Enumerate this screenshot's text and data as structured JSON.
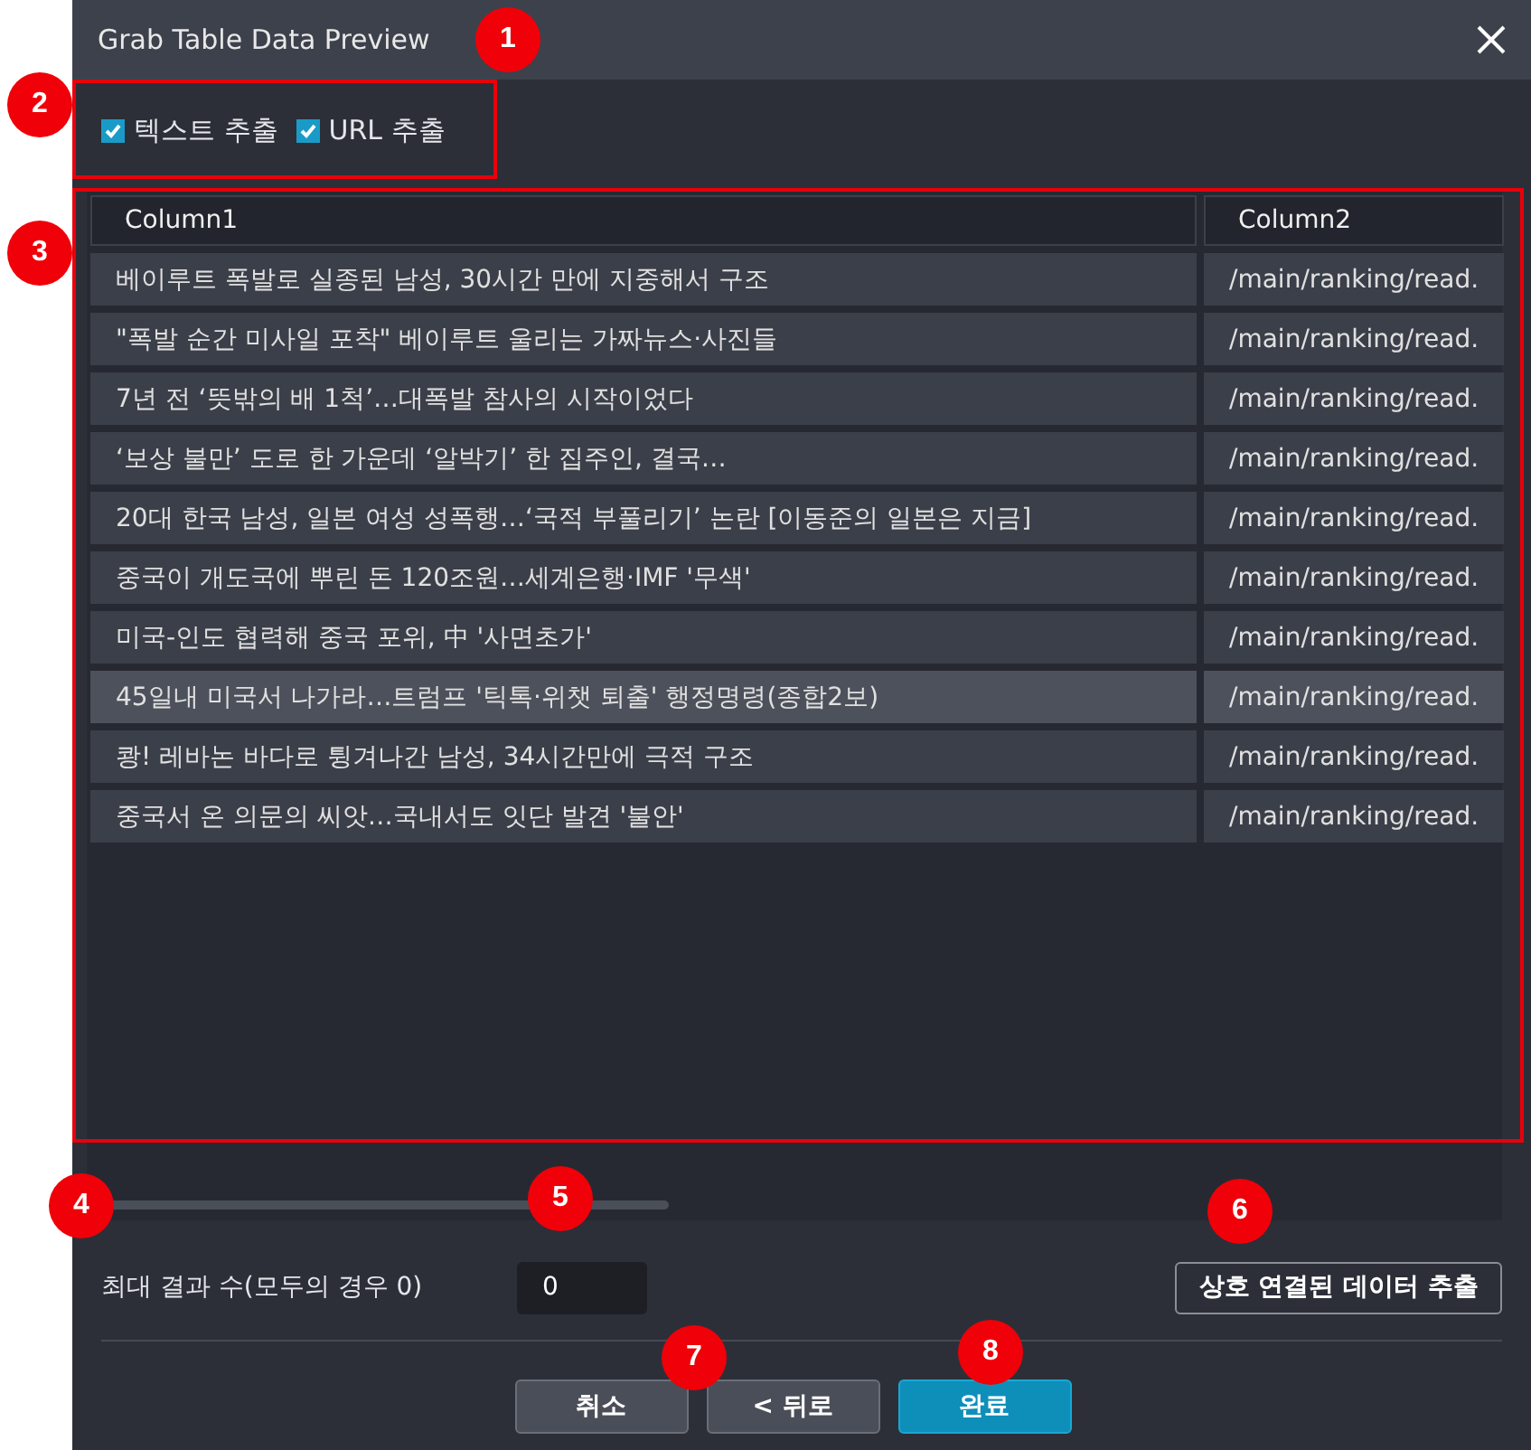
{
  "window": {
    "title": "Grab Table Data Preview"
  },
  "options": [
    {
      "label": "텍스트 추출",
      "checked": true
    },
    {
      "label": "URL 추출",
      "checked": true
    }
  ],
  "table": {
    "columns": [
      "Column1",
      "Column2"
    ],
    "rows": [
      {
        "cells": [
          "베이루트 폭발로 실종된 남성, 30시간 만에 지중해서 구조",
          "/main/ranking/read."
        ],
        "selected": false
      },
      {
        "cells": [
          "\"폭발 순간 미사일 포착\" 베이루트 울리는 가짜뉴스·사진들",
          "/main/ranking/read."
        ],
        "selected": false
      },
      {
        "cells": [
          "7년 전 ‘뜻밖의 배 1척’…대폭발 참사의 시작이었다",
          "/main/ranking/read."
        ],
        "selected": false
      },
      {
        "cells": [
          "‘보상 불만’ 도로 한 가운데 ‘알박기’ 한 집주인, 결국…",
          "/main/ranking/read."
        ],
        "selected": false
      },
      {
        "cells": [
          "20대 한국 남성, 일본 여성 성폭행…‘국적 부풀리기’ 논란 [이동준의 일본은 지금]",
          "/main/ranking/read."
        ],
        "selected": false
      },
      {
        "cells": [
          "중국이 개도국에 뿌린 돈 120조원…세계은행·IMF '무색'",
          "/main/ranking/read."
        ],
        "selected": false
      },
      {
        "cells": [
          "미국-인도 협력해 중국 포위, 中 '사면초가'",
          "/main/ranking/read."
        ],
        "selected": false
      },
      {
        "cells": [
          "45일내 미국서 나가라…트럼프 '틱톡·위챗 퇴출' 행정명령(종합2보)",
          "/main/ranking/read."
        ],
        "selected": true
      },
      {
        "cells": [
          "쾅! 레바논 바다로 튕겨나간 남성, 34시간만에 극적 구조",
          "/main/ranking/read."
        ],
        "selected": false
      },
      {
        "cells": [
          "중국서 온 의문의 씨앗…국내서도 잇단 발견 '불안'",
          "/main/ranking/read."
        ],
        "selected": false
      }
    ]
  },
  "max_results": {
    "label": "최대 결과 수(모두의 경우 0)",
    "value": "0"
  },
  "linked_button": "상호 연결된 데이터 추출",
  "buttons": [
    {
      "label": "취소",
      "kind": "secondary"
    },
    {
      "label": "< 뒤로",
      "kind": "secondary"
    },
    {
      "label": "완료",
      "kind": "primary"
    }
  ],
  "annotations": [
    {
      "label": "1"
    },
    {
      "label": "2"
    },
    {
      "label": "3"
    },
    {
      "label": "4"
    },
    {
      "label": "5"
    },
    {
      "label": "6"
    },
    {
      "label": "7"
    },
    {
      "label": "8"
    }
  ]
}
